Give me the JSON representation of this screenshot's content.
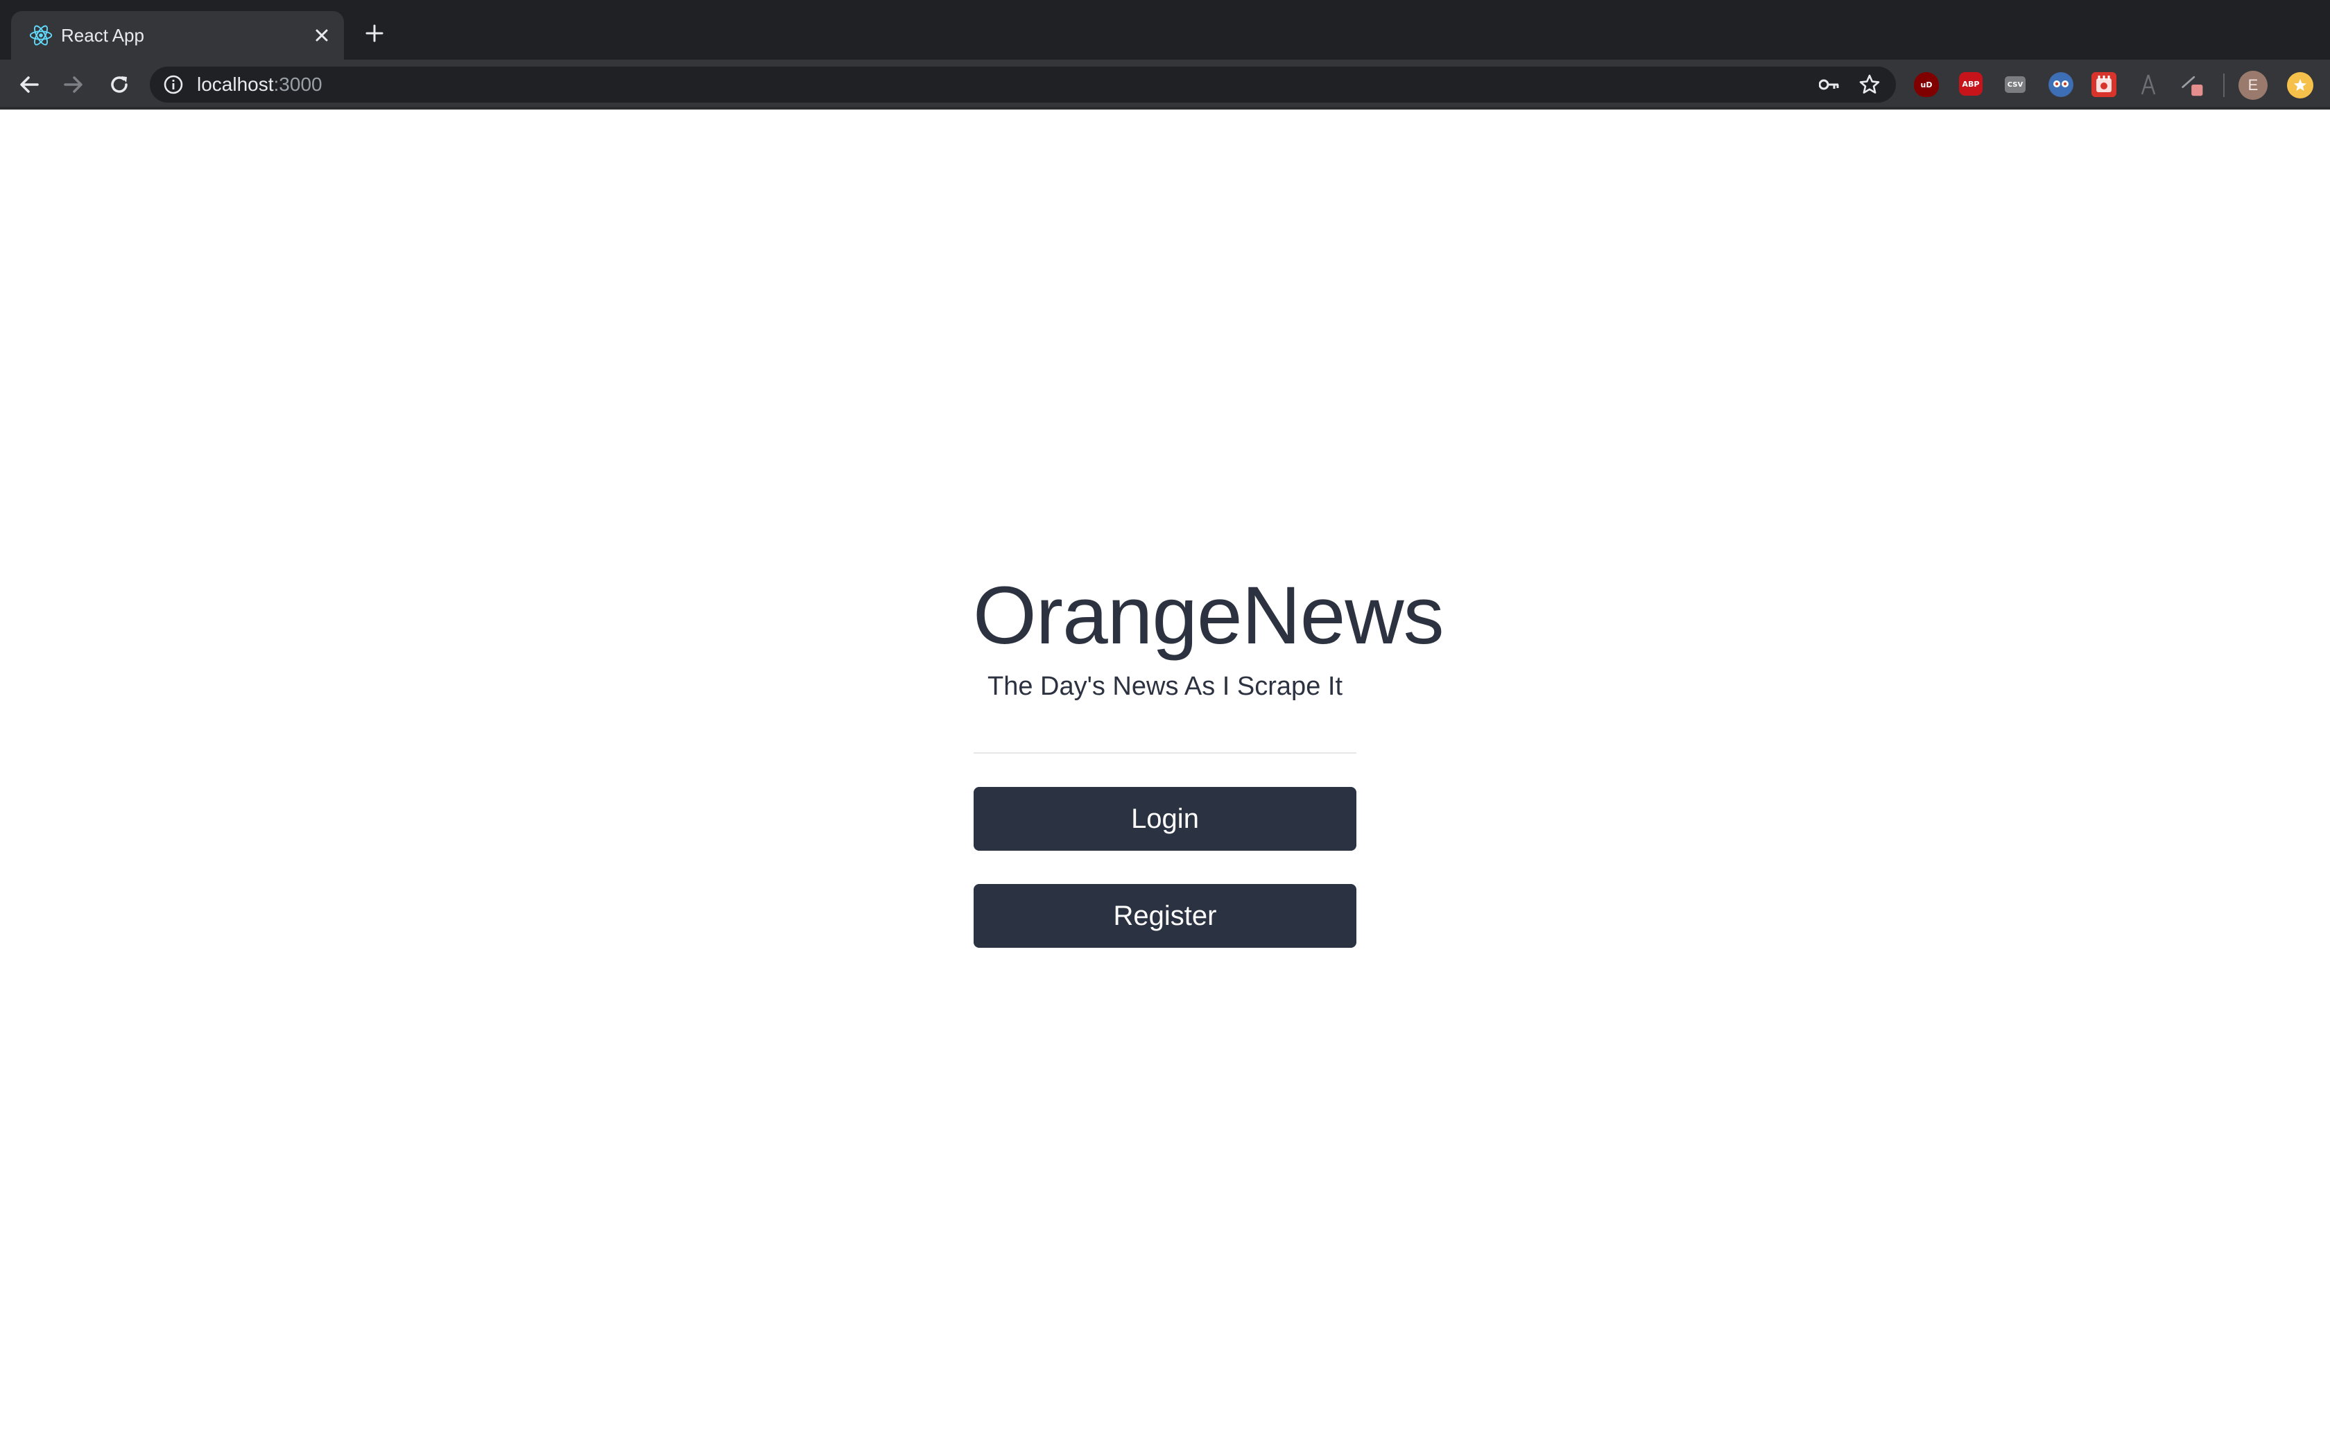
{
  "browser": {
    "tab": {
      "title": "React App",
      "favicon": "react-logo-icon"
    },
    "new_tab_icon": "plus-icon",
    "nav": {
      "back_icon": "arrow-left-icon",
      "forward_icon": "arrow-right-icon",
      "reload_icon": "reload-icon"
    },
    "omnibox": {
      "info_icon": "info-icon",
      "host": "localhost",
      "port": ":3000",
      "key_icon": "key-icon",
      "bookmark_icon": "star-icon"
    },
    "extensions": [
      {
        "name": "ublock-icon",
        "label": "uD"
      },
      {
        "name": "adblock-plus-icon",
        "label": "ABP"
      },
      {
        "name": "csv-icon",
        "label": "CSV"
      },
      {
        "name": "eyes-extension-icon",
        "label": ""
      },
      {
        "name": "red-extension-icon",
        "label": ""
      },
      {
        "name": "gray-extension-icon",
        "label": ""
      },
      {
        "name": "pen-extension-icon",
        "label": ""
      }
    ],
    "profile": {
      "initial": "E"
    },
    "colors": {
      "tabstrip": "#202124",
      "toolbar": "#35363a",
      "omnibox": "#202124"
    }
  },
  "page": {
    "brand": "OrangeNews",
    "tagline": "The Day's News As I Scrape It",
    "buttons": {
      "login": "Login",
      "register": "Register"
    },
    "colors": {
      "text": "#2c3240",
      "button_bg": "#2b3242",
      "button_text": "#ffffff",
      "divider": "#e6e7e9"
    }
  }
}
